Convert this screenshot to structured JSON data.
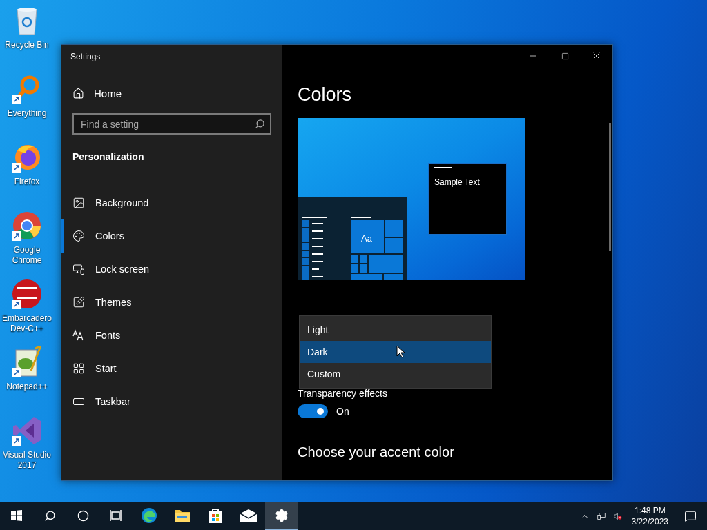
{
  "desktop_icons": [
    {
      "label": "Recycle Bin"
    },
    {
      "label": "Everything"
    },
    {
      "label": "Firefox"
    },
    {
      "label": "Google Chrome"
    },
    {
      "label": "Embarcadero Dev-C++"
    },
    {
      "label": "Notepad++"
    },
    {
      "label": "Visual Studio 2017"
    }
  ],
  "window": {
    "title": "Settings",
    "home": "Home",
    "search": {
      "placeholder": "Find a setting"
    },
    "section": "Personalization",
    "nav": [
      {
        "label": "Background",
        "selected": false
      },
      {
        "label": "Colors",
        "selected": true
      },
      {
        "label": "Lock screen",
        "selected": false
      },
      {
        "label": "Themes",
        "selected": false
      },
      {
        "label": "Fonts",
        "selected": false
      },
      {
        "label": "Start",
        "selected": false
      },
      {
        "label": "Taskbar",
        "selected": false
      }
    ],
    "page_title": "Colors",
    "preview": {
      "tile_text": "Aa",
      "sample_text": "Sample Text"
    },
    "mode_dropdown": {
      "options": [
        {
          "label": "Light",
          "selected": false
        },
        {
          "label": "Dark",
          "selected": true
        },
        {
          "label": "Custom",
          "selected": false
        }
      ]
    },
    "transparency": {
      "label": "Transparency effects",
      "on": true,
      "state_text": "On"
    },
    "accent_heading": "Choose your accent color"
  },
  "taskbar": {
    "pinned": [
      {
        "selected": false
      },
      {
        "selected": false
      },
      {
        "selected": false
      },
      {
        "selected": false
      },
      {
        "selected": false
      },
      {
        "selected": false
      },
      {
        "selected": true
      }
    ],
    "time": "1:48 PM",
    "date": "3/22/2023"
  }
}
